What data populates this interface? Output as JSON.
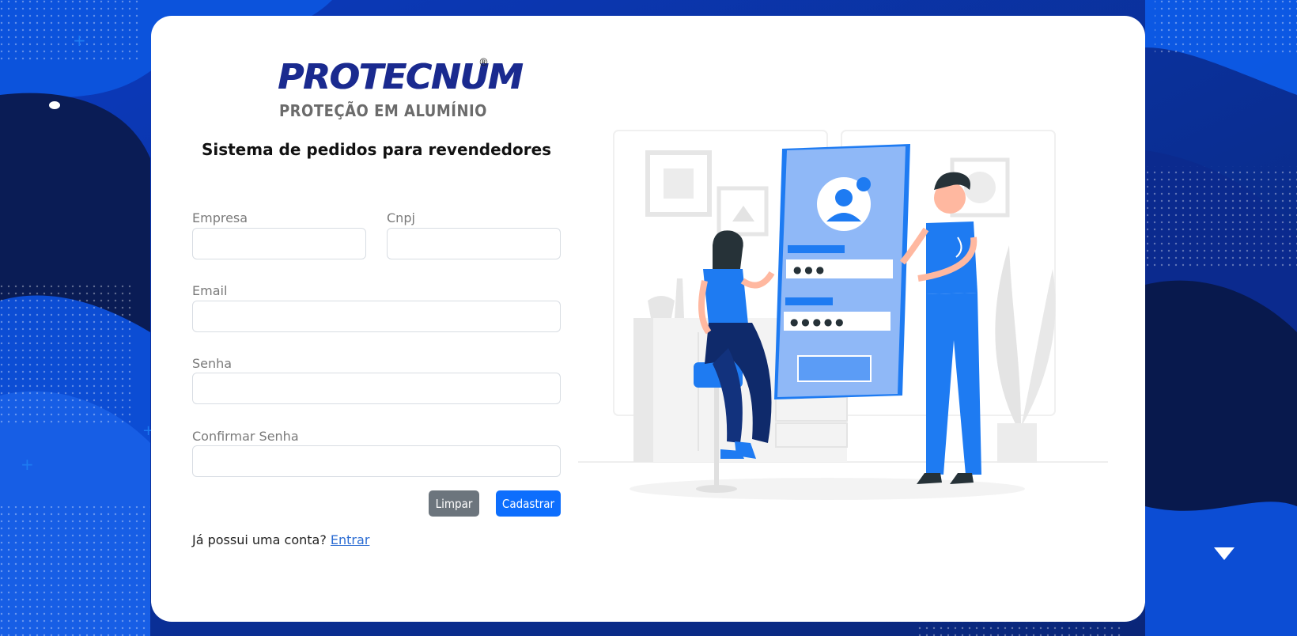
{
  "brand": {
    "name": "PROTECNUM",
    "registered_mark": "®",
    "tagline": "PROTEÇÃO EM ALUMÍNIO"
  },
  "page_title": "Sistema de pedidos para revendedores",
  "form": {
    "empresa_label": "Empresa",
    "empresa_value": "",
    "cnpj_label": "Cnpj",
    "cnpj_value": "",
    "email_label": "Email",
    "email_value": "",
    "senha_label": "Senha",
    "senha_value": "",
    "confirmar_label": "Confirmar Senha",
    "confirmar_value": ""
  },
  "buttons": {
    "clear_label": "Limpar",
    "submit_label": "Cadastrar"
  },
  "login_prompt": {
    "text": "Já possui uma conta?",
    "link_label": "Entrar"
  },
  "illustration": {
    "password_dots_1": "● ● ●",
    "password_dots_2": "● ● ● ● ●"
  },
  "colors": {
    "background": "#0a2a8c",
    "primary": "#0d6efd",
    "secondary": "#6c757d",
    "brand_blue": "#1a2a8f",
    "illustration_blue": "#1e7bf2"
  }
}
